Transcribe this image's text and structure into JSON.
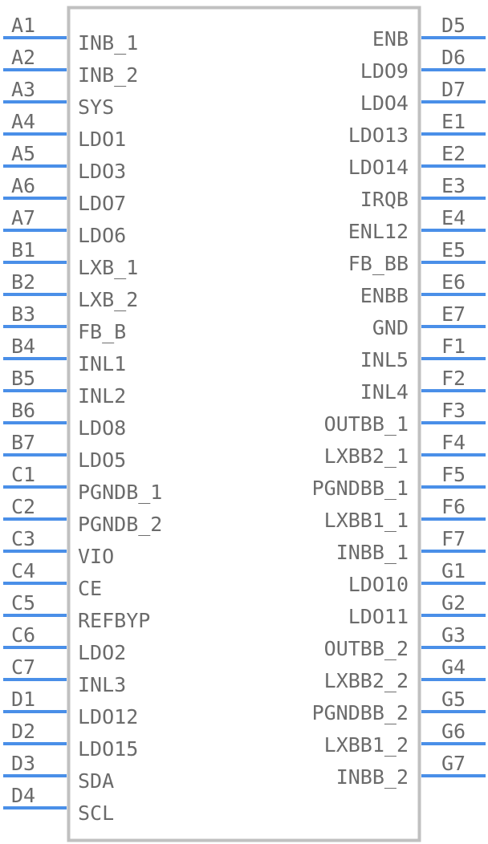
{
  "component": {
    "body_color": "#c0c0c0",
    "pin_color": "#4a8fe8",
    "text_color": "#6b6b6b"
  },
  "left_pins": [
    {
      "number": "A1",
      "name": "INB_1"
    },
    {
      "number": "A2",
      "name": "INB_2"
    },
    {
      "number": "A3",
      "name": "SYS"
    },
    {
      "number": "A4",
      "name": "LDO1"
    },
    {
      "number": "A5",
      "name": "LDO3"
    },
    {
      "number": "A6",
      "name": "LDO7"
    },
    {
      "number": "A7",
      "name": "LDO6"
    },
    {
      "number": "B1",
      "name": "LXB_1"
    },
    {
      "number": "B2",
      "name": "LXB_2"
    },
    {
      "number": "B3",
      "name": "FB_B"
    },
    {
      "number": "B4",
      "name": "INL1"
    },
    {
      "number": "B5",
      "name": "INL2"
    },
    {
      "number": "B6",
      "name": "LDO8"
    },
    {
      "number": "B7",
      "name": "LDO5"
    },
    {
      "number": "C1",
      "name": "PGNDB_1"
    },
    {
      "number": "C2",
      "name": "PGNDB_2"
    },
    {
      "number": "C3",
      "name": "VIO"
    },
    {
      "number": "C4",
      "name": "CE"
    },
    {
      "number": "C5",
      "name": "REFBYP"
    },
    {
      "number": "C6",
      "name": "LDO2"
    },
    {
      "number": "C7",
      "name": "INL3"
    },
    {
      "number": "D1",
      "name": "LDO12"
    },
    {
      "number": "D2",
      "name": "LDO15"
    },
    {
      "number": "D3",
      "name": "SDA"
    },
    {
      "number": "D4",
      "name": "SCL"
    }
  ],
  "right_pins": [
    {
      "number": "D5",
      "name": "ENB"
    },
    {
      "number": "D6",
      "name": "LDO9"
    },
    {
      "number": "D7",
      "name": "LDO4"
    },
    {
      "number": "E1",
      "name": "LDO13"
    },
    {
      "number": "E2",
      "name": "LDO14"
    },
    {
      "number": "E3",
      "name": "IRQB"
    },
    {
      "number": "E4",
      "name": "ENL12"
    },
    {
      "number": "E5",
      "name": "FB_BB"
    },
    {
      "number": "E6",
      "name": "ENBB"
    },
    {
      "number": "E7",
      "name": "GND"
    },
    {
      "number": "F1",
      "name": "INL5"
    },
    {
      "number": "F2",
      "name": "INL4"
    },
    {
      "number": "F3",
      "name": "OUTBB_1"
    },
    {
      "number": "F4",
      "name": "LXBB2_1"
    },
    {
      "number": "F5",
      "name": "PGNDBB_1"
    },
    {
      "number": "F6",
      "name": "LXBB1_1"
    },
    {
      "number": "F7",
      "name": "INBB_1"
    },
    {
      "number": "G1",
      "name": "LDO10"
    },
    {
      "number": "G2",
      "name": "LDO11"
    },
    {
      "number": "G3",
      "name": "OUTBB_2"
    },
    {
      "number": "G4",
      "name": "LXBB2_2"
    },
    {
      "number": "G5",
      "name": "PGNDBB_2"
    },
    {
      "number": "G6",
      "name": "LXBB1_2"
    },
    {
      "number": "G7",
      "name": "INBB_2"
    }
  ]
}
